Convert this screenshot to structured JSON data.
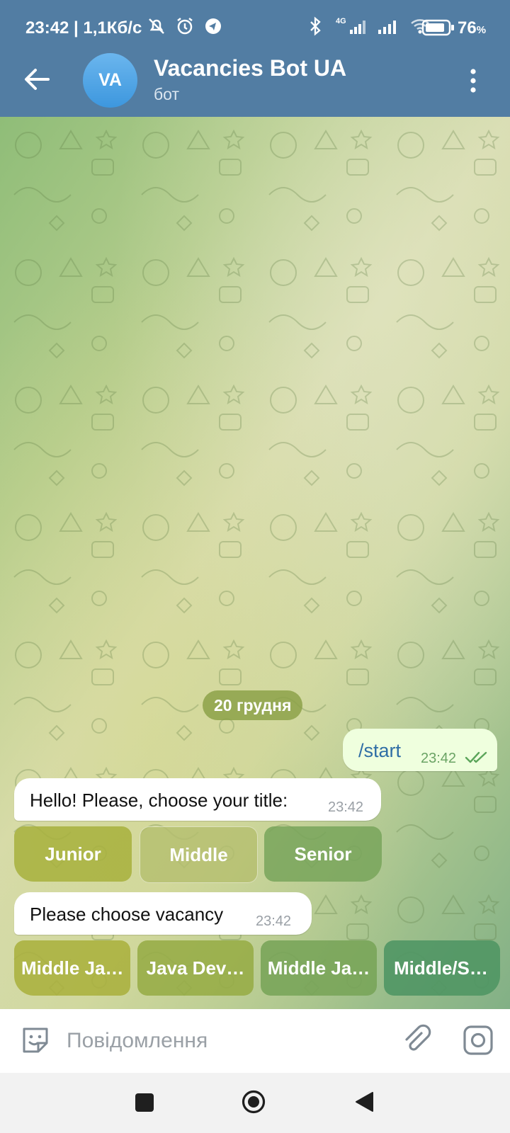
{
  "status_bar": {
    "time_speed": "23:42 | 1,1Кб/с",
    "battery": "76",
    "battery_unit": "%",
    "network_label": "4G",
    "icons": [
      "mute-icon",
      "alarm-icon",
      "app-notification-icon",
      "bluetooth-icon",
      "signal-4g-icon",
      "signal-icon",
      "wifi-icon",
      "battery-icon"
    ]
  },
  "header": {
    "avatar_initials": "VA",
    "title": "Vacancies Bot UA",
    "subtitle": "бот",
    "colors": {
      "bar": "#527da3",
      "avatar": "#4aa3e3"
    }
  },
  "chat": {
    "date_label": "20 грудня",
    "messages": [
      {
        "direction": "out",
        "text": "/start",
        "time": "23:42",
        "read": true
      },
      {
        "direction": "in",
        "text": "Hello! Please, choose your title:",
        "time": "23:42"
      },
      {
        "direction": "in",
        "text": "Please choose vacancy",
        "time": "23:42"
      }
    ],
    "title_buttons": [
      "Junior",
      "Middle",
      "Senior"
    ],
    "vacancy_buttons": [
      "Middle Ja…",
      "Java Dev…",
      "Middle Ja…",
      "Middle/S…"
    ]
  },
  "input": {
    "placeholder": "Повідомлення",
    "value": ""
  },
  "navbar": {
    "icons": [
      "recents-square-icon",
      "home-circle-icon",
      "back-triangle-icon"
    ]
  }
}
